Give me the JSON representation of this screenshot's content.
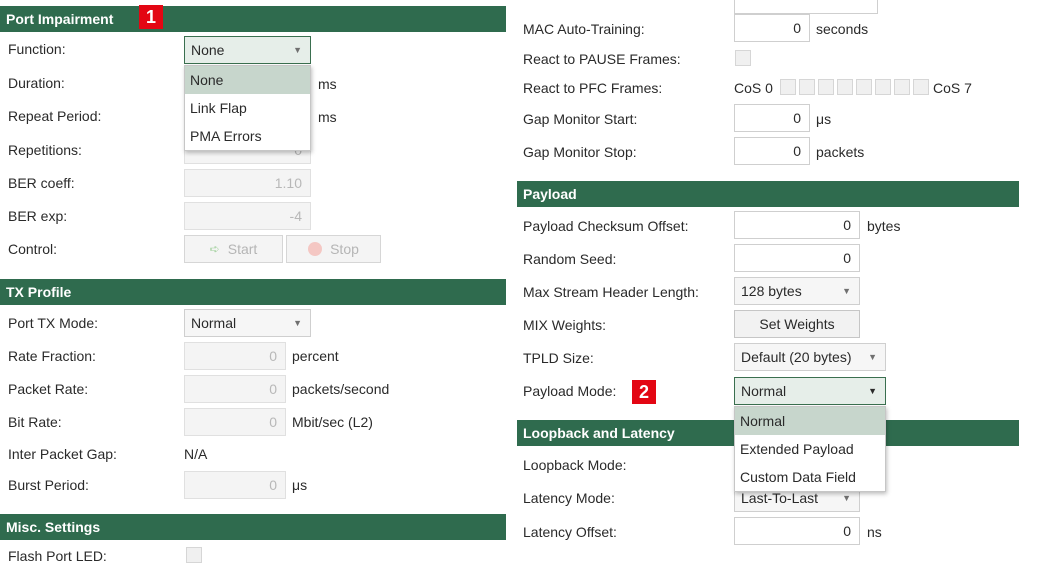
{
  "markers": {
    "port_impairment": "1",
    "payload_mode": "2"
  },
  "port_impairment": {
    "title": "Port Impairment",
    "function": {
      "label": "Function:",
      "value": "None",
      "options": [
        "None",
        "Link Flap",
        "PMA Errors"
      ]
    },
    "duration": {
      "label": "Duration:",
      "unit": "ms"
    },
    "repeat_period": {
      "label": "Repeat Period:",
      "unit": "ms"
    },
    "repetitions": {
      "label": "Repetitions:",
      "value": "0"
    },
    "ber_coeff": {
      "label": "BER coeff:",
      "value": "1.10"
    },
    "ber_exp": {
      "label": "BER exp:",
      "value": "-4"
    },
    "control": {
      "label": "Control:",
      "start": "Start",
      "stop": "Stop"
    }
  },
  "tx_profile": {
    "title": "TX Profile",
    "port_tx_mode": {
      "label": "Port TX Mode:",
      "value": "Normal"
    },
    "rate_fraction": {
      "label": "Rate Fraction:",
      "value": "0",
      "unit": "percent"
    },
    "packet_rate": {
      "label": "Packet Rate:",
      "value": "0",
      "unit": "packets/second"
    },
    "bit_rate": {
      "label": "Bit Rate:",
      "value": "0",
      "unit": "Mbit/sec (L2)"
    },
    "inter_packet_gap": {
      "label": "Inter Packet Gap:",
      "value": "N/A"
    },
    "burst_period": {
      "label": "Burst Period:",
      "value": "0",
      "unit": "μs"
    }
  },
  "misc": {
    "title": "Misc. Settings",
    "flash_port_led": {
      "label": "Flash Port LED:"
    }
  },
  "right_top": {
    "mac_auto_training": {
      "label": "MAC Auto-Training:",
      "value": "0",
      "unit": "seconds"
    },
    "react_pause": {
      "label": "React to PAUSE Frames:"
    },
    "react_pfc": {
      "label": "React to PFC Frames:",
      "cos_start": "CoS 0",
      "cos_end": "CoS 7"
    },
    "gap_monitor_start": {
      "label": "Gap Monitor Start:",
      "value": "0",
      "unit": "μs"
    },
    "gap_monitor_stop": {
      "label": "Gap Monitor Stop:",
      "value": "0",
      "unit": "packets"
    }
  },
  "payload": {
    "title": "Payload",
    "checksum_offset": {
      "label": "Payload Checksum Offset:",
      "value": "0",
      "unit": "bytes"
    },
    "random_seed": {
      "label": "Random Seed:",
      "value": "0"
    },
    "max_stream_header": {
      "label": "Max Stream Header Length:",
      "value": "128 bytes"
    },
    "mix_weights": {
      "label": "MIX Weights:",
      "button": "Set Weights"
    },
    "tpld_size": {
      "label": "TPLD Size:",
      "value": "Default (20 bytes)"
    },
    "payload_mode": {
      "label": "Payload Mode:",
      "value": "Normal",
      "options": [
        "Normal",
        "Extended Payload",
        "Custom Data Field"
      ]
    }
  },
  "loopback": {
    "title": "Loopback and Latency",
    "loopback_mode": {
      "label": "Loopback Mode:"
    },
    "latency_mode": {
      "label": "Latency Mode:",
      "value": "Last-To-Last"
    },
    "latency_offset": {
      "label": "Latency Offset:",
      "value": "0",
      "unit": "ns"
    }
  },
  "colors": {
    "header_bg": "#2f6b4e",
    "marker_bg": "#e30613",
    "selected_option": "#c7d6cc"
  }
}
